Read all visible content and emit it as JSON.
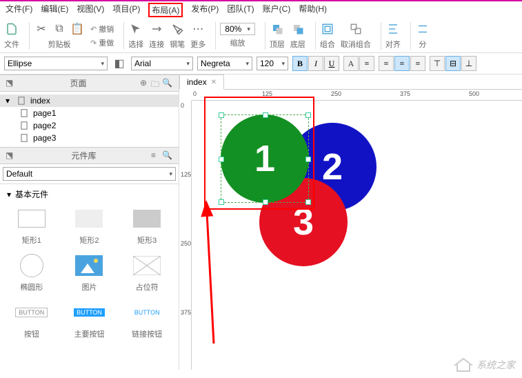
{
  "menu": {
    "file": "文件(F)",
    "edit": "编辑(E)",
    "view": "视图(V)",
    "project": "项目(P)",
    "layout": "布局(A)",
    "publish": "发布(P)",
    "team": "团队(T)",
    "account": "账户(C)",
    "help": "帮助(H)"
  },
  "toolbar": {
    "file": "文件",
    "clipboard": "剪贴板",
    "undo": "撤销",
    "redo": "重做",
    "select": "选择",
    "connect": "连接",
    "pen": "钢笔",
    "more": "更多",
    "zoom": "缩放",
    "zoom_val": "80%",
    "top": "顶层",
    "bottom": "底层",
    "group": "组合",
    "ungroup": "取消组合",
    "align": "对齐",
    "distribute": "分"
  },
  "format": {
    "shape": "Ellipse",
    "font": "Arial",
    "weight": "Negreta",
    "size": "120",
    "bold": "B",
    "italic": "I",
    "underline": "U"
  },
  "pages": {
    "title": "页面",
    "root": "index",
    "p1": "page1",
    "p2": "page2",
    "p3": "page3"
  },
  "lib": {
    "title": "元件库",
    "default": "Default",
    "basic": "基本元件",
    "rect1": "矩形1",
    "rect2": "矩形2",
    "rect3": "矩形3",
    "ellipse": "椭圆形",
    "image": "图片",
    "placeholder": "占位符",
    "btn": "按钮",
    "btnMain": "主要按钮",
    "btnLink": "链接按钮",
    "btnTxt": "BUTTON"
  },
  "tab": {
    "name": "index"
  },
  "ruler": {
    "r0": "0",
    "r125": "125",
    "r250": "250",
    "r375": "375",
    "r500": "500"
  },
  "circles": {
    "c1": "1",
    "c2": "2",
    "c3": "3"
  },
  "watermark": "系统之家"
}
